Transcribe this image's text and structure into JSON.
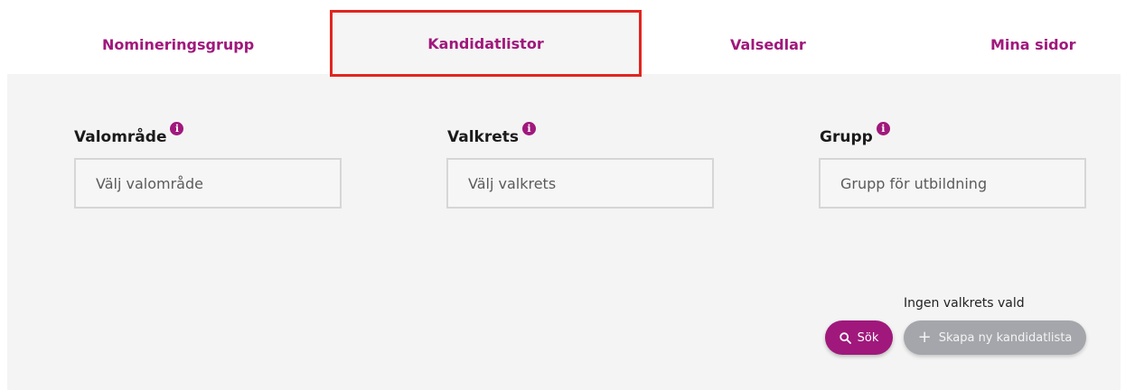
{
  "nav": {
    "tabs": [
      {
        "label": "Nomineringsgrupp",
        "active": false
      },
      {
        "label": "Kandidatlistor",
        "active": true
      },
      {
        "label": "Valsedlar",
        "active": false
      },
      {
        "label": "Mina sidor",
        "active": false
      }
    ]
  },
  "filters": {
    "valomrade": {
      "label": "Valområde",
      "placeholder": "Välj valområde"
    },
    "valkrets": {
      "label": "Valkrets",
      "placeholder": "Välj valkrets"
    },
    "grupp": {
      "label": "Grupp",
      "value": "Grupp för utbildning"
    }
  },
  "actions": {
    "status": "Ingen valkrets vald",
    "search_label": "Sök",
    "create_label": "Skapa ny kandidatlista"
  },
  "colors": {
    "accent": "#a0187c",
    "highlight_border": "#e1251f",
    "disabled_button": "#a4a6ab",
    "panel_bg": "#f4f4f4"
  },
  "icons": {
    "info": "info-icon",
    "search": "search-icon",
    "plus": "plus-icon"
  }
}
